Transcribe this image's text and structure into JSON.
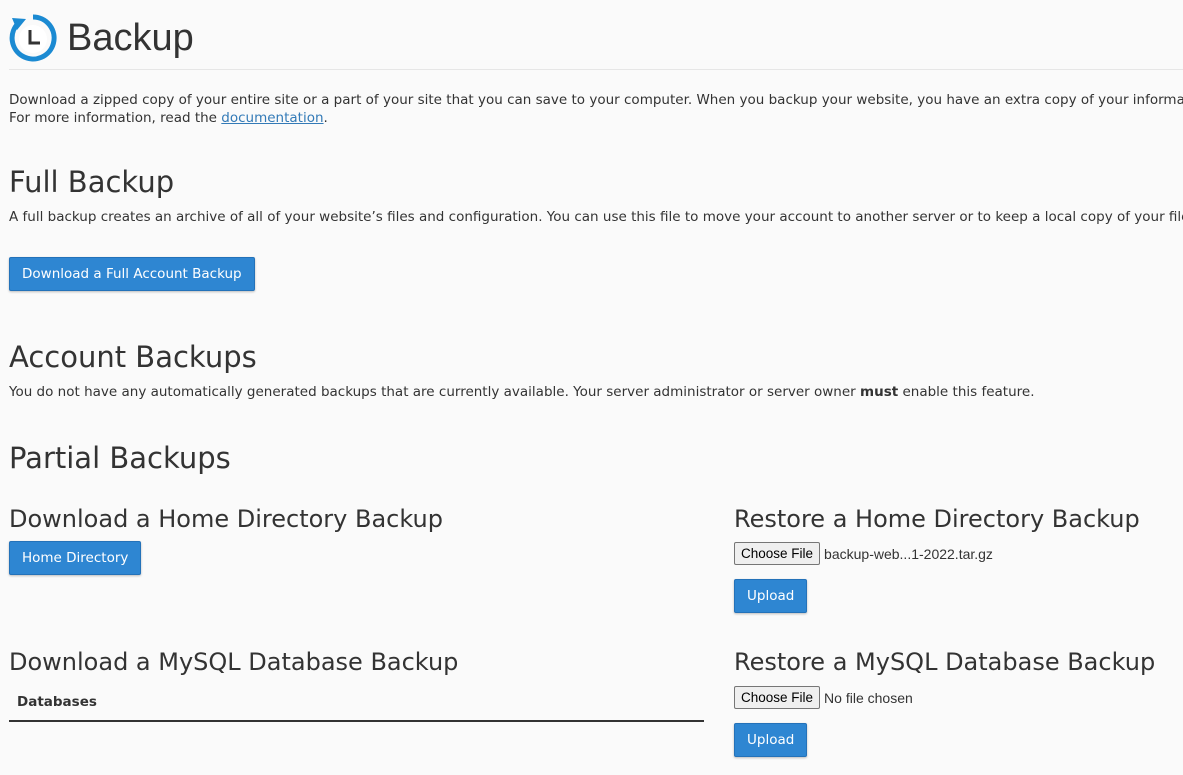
{
  "header": {
    "title": "Backup",
    "logo_icon": "backup-restore-icon",
    "accent_color": "#1b8ad2"
  },
  "intro": {
    "line1": "Download a zipped copy of your entire site or a part of your site that you can save to your computer. When you backup your website, you have an extra copy of your information in c",
    "line2_prefix": "For more information, read the ",
    "link_text": "documentation",
    "line2_suffix": "."
  },
  "full_backup": {
    "title": "Full Backup",
    "description": "A full backup creates an archive of all of your website’s files and configuration. You can use this file to move your account to another server or to keep a local copy of your files.",
    "button_label": "Download a Full Account Backup"
  },
  "account_backups": {
    "title": "Account Backups",
    "text_before": "You do not have any automatically generated backups that are currently available. Your server administrator or server owner ",
    "text_bold": "must",
    "text_after": " enable this feature."
  },
  "partial_backups": {
    "title": "Partial Backups",
    "home_download": {
      "title": "Download a Home Directory Backup",
      "button_label": "Home Directory"
    },
    "home_restore": {
      "title": "Restore a Home Directory Backup",
      "choose_file_label": "Choose File",
      "file_name": "backup-web...1-2022.tar.gz",
      "upload_label": "Upload"
    },
    "mysql_download": {
      "title": "Download a MySQL Database Backup",
      "table_header": "Databases"
    },
    "mysql_restore": {
      "title": "Restore a MySQL Database Backup",
      "choose_file_label": "Choose File",
      "file_name": "No file chosen",
      "upload_label": "Upload"
    }
  },
  "colors": {
    "button_bg": "#2e86d2",
    "link": "#337ab7",
    "text": "#333333"
  }
}
